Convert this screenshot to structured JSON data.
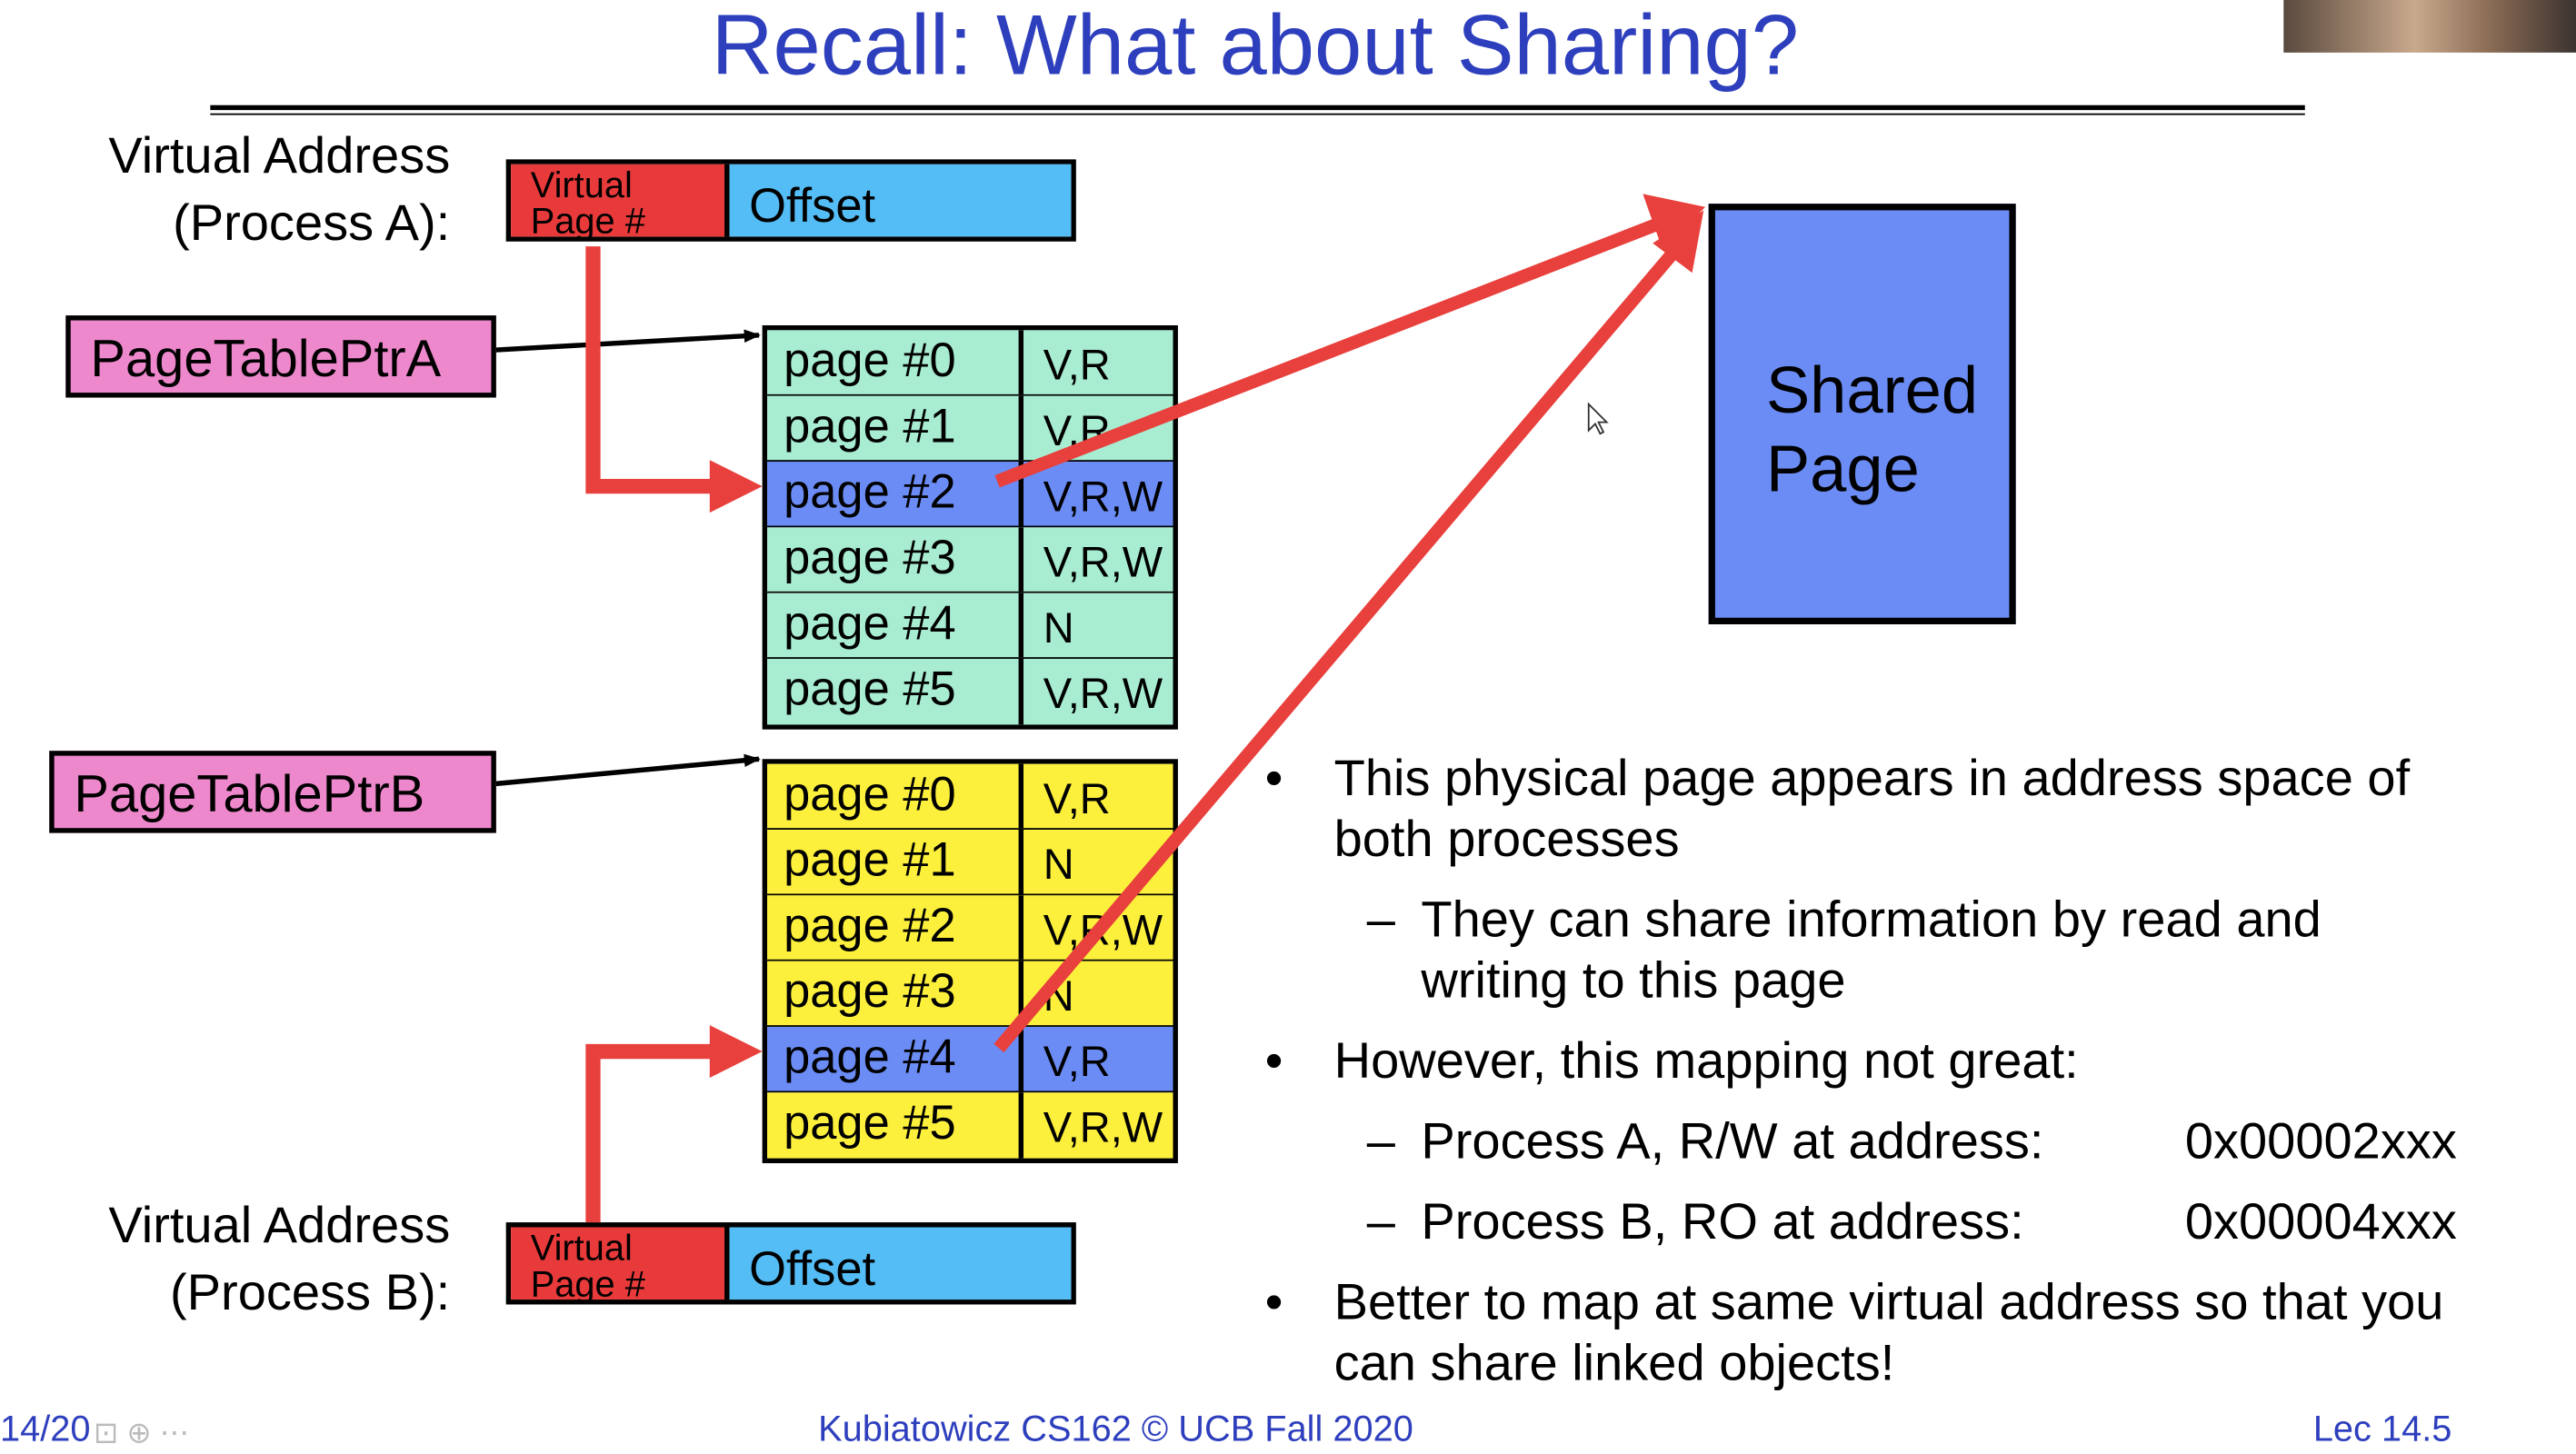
{
  "title": "Recall: What about Sharing?",
  "process_a": {
    "label_line1": "Virtual Address",
    "label_line2": "(Process A):",
    "vpn_line1": "Virtual",
    "vpn_line2": "Page #",
    "offset": "Offset"
  },
  "process_b": {
    "label_line1": "Virtual Address",
    "label_line2": "(Process B):",
    "vpn_line1": "Virtual",
    "vpn_line2": "Page #",
    "offset": "Offset"
  },
  "ptr_a": "PageTablePtrA",
  "ptr_b": "PageTablePtrB",
  "table_a": [
    {
      "page": "page #0",
      "flags": "V,R"
    },
    {
      "page": "page #1",
      "flags": "V,R"
    },
    {
      "page": "page #2",
      "flags": "V,R,W"
    },
    {
      "page": "page #3",
      "flags": "V,R,W"
    },
    {
      "page": "page #4",
      "flags": "N"
    },
    {
      "page": "page #5",
      "flags": "V,R,W"
    }
  ],
  "table_b": [
    {
      "page": "page #0",
      "flags": "V,R"
    },
    {
      "page": "page #1",
      "flags": "N"
    },
    {
      "page": "page #2",
      "flags": "V,R,W"
    },
    {
      "page": "page #3",
      "flags": "N"
    },
    {
      "page": "page #4",
      "flags": "V,R"
    },
    {
      "page": "page #5",
      "flags": "V,R,W"
    }
  ],
  "shared_page": {
    "line1": "Shared",
    "line2": "Page"
  },
  "bullets": {
    "b1_line1": "This physical page appears in address space of",
    "b1_line2": "both processes",
    "s1_line1": "They can share information by read and",
    "s1_line2": "writing to this page",
    "b2": "However, this mapping not great:",
    "s2_label": "Process A, R/W at address:",
    "s2_value": "0x00002xxx",
    "s3_label": "Process B, RO at address:",
    "s3_value": "0x00004xxx",
    "b3_line1": "Better to map at same virtual address so that you",
    "b3_line2": "can share linked objects!",
    "bullet_glyph": "•",
    "dash_glyph": "–"
  },
  "footer": {
    "slide_counter": "14/20",
    "center": "Kubiatowicz CS162 © UCB Fall 2020",
    "right": "Lec 14.5"
  },
  "colors": {
    "title": "#2e3fbd",
    "table_a": "#a8ecd2",
    "table_b": "#fcf03c",
    "highlight": "#6b8cf5",
    "vpn": "#e83a3a",
    "offset": "#54bdf5",
    "ptr": "#ee88cc",
    "arrow": "#e8403c"
  },
  "highlight_rows": {
    "table_a": 2,
    "table_b": 4
  }
}
